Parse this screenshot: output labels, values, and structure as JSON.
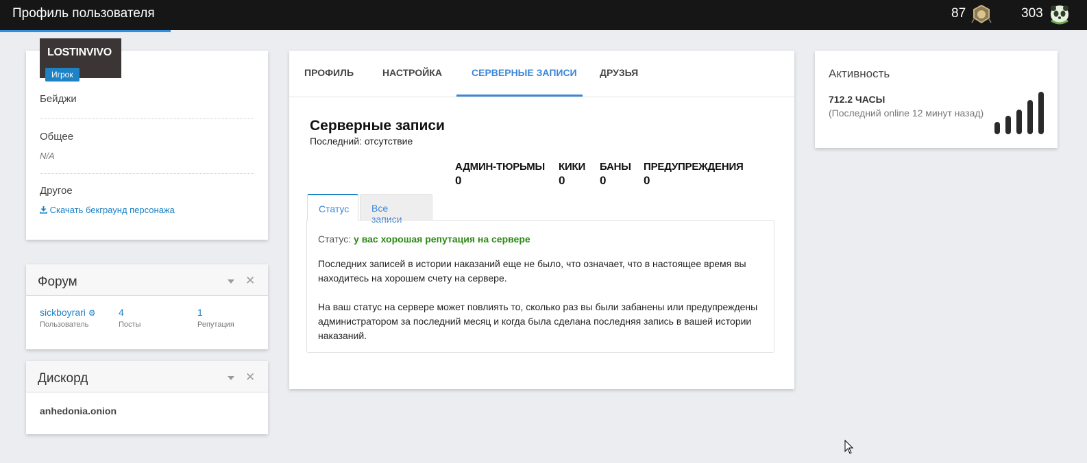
{
  "topbar": {
    "title": "Профиль пользователя",
    "counters": [
      {
        "value": "87",
        "icon": "rank-badge-icon"
      },
      {
        "value": "303",
        "icon": "panda-avatar-icon"
      }
    ]
  },
  "profile": {
    "username": "LOSTINVIVO",
    "role": "Игрок",
    "sections": {
      "badges_title": "Бейджи",
      "general_title": "Общее",
      "general_value": "N/A",
      "other_title": "Другое",
      "download_link": "Скачать бекграунд персонажа"
    }
  },
  "forum_widget": {
    "title": "Форум",
    "user": "sickboyrari",
    "user_label": "Пользователь",
    "posts": "4",
    "posts_label": "Посты",
    "reputation": "1",
    "reputation_label": "Репутация"
  },
  "discord_widget": {
    "title": "Дискорд",
    "username": "anhedonia.onion"
  },
  "main": {
    "tabs": [
      {
        "label": "ПРОФИЛЬ",
        "active": false
      },
      {
        "label": "НАСТРОЙКА",
        "active": false
      },
      {
        "label": "СЕРВЕРНЫЕ ЗАПИСИ",
        "active": true
      },
      {
        "label": "ДРУЗЬЯ",
        "active": false
      }
    ],
    "records_title": "Серверные записи",
    "records_last": "Последний: отсутствие",
    "stats": [
      {
        "label": "АДМИН-ТЮРЬМЫ",
        "value": "0"
      },
      {
        "label": "КИКИ",
        "value": "0"
      },
      {
        "label": "БАНЫ",
        "value": "0"
      },
      {
        "label": "ПРЕДУПРЕЖДЕНИЯ",
        "value": "0"
      }
    ],
    "subtabs": [
      {
        "label": "Статус",
        "active": true
      },
      {
        "label": "Все записи",
        "active": false
      }
    ],
    "status_prefix": "Статус:",
    "status_text": "у вас хорошая репутация на сервере",
    "status_color": "#2d8a16",
    "paragraph_1": "Последних записей в истории наказаний еще не было, что означает, что в настоящее время вы находитесь на хорошем счету на сервере.",
    "paragraph_2": "На ваш статус на сервере может повлиять то, сколько раз вы были забанены или предупреждены администратором за последний месяц и когда была сделана последняя запись в вашей истории наказаний."
  },
  "activity": {
    "title": "Активность",
    "hours": "712.2 ЧАСЫ",
    "last_online": "(Последний online 12 минут назад)",
    "signal_level": 5
  },
  "colors": {
    "accent": "#3a86d8",
    "topbar": "#161616",
    "role_badge": "#1d82c6"
  }
}
